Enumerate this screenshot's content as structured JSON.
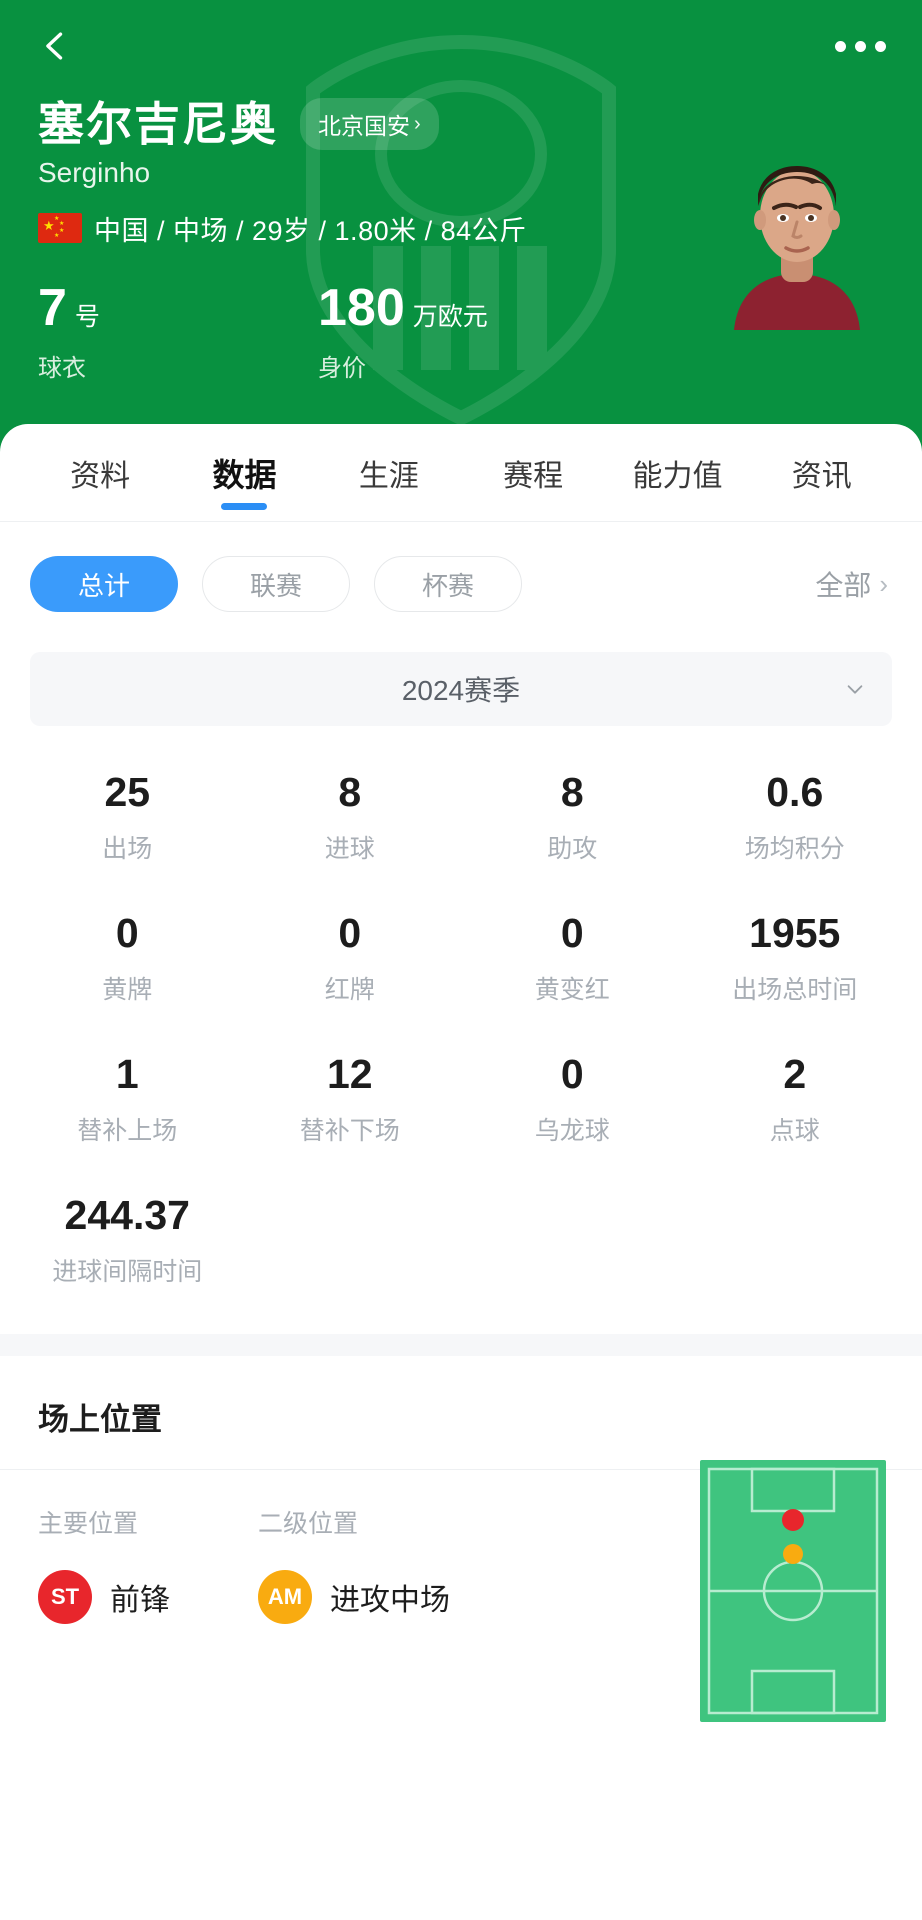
{
  "topbar": {
    "back_icon": "chevron-left-icon",
    "more_icon": "more-options-icon"
  },
  "player": {
    "name_cn": "塞尔吉尼奥",
    "name_en": "Serginho",
    "team": "北京国安",
    "team_chevron": "›",
    "nationality": "中国",
    "meta": "中国 / 中场 / 29岁 / 1.80米 / 84公斤",
    "jersey_number": "7",
    "jersey_unit": "号",
    "jersey_label": "球衣",
    "value_number": "180",
    "value_unit": "万欧元",
    "value_label": "身价"
  },
  "tabs": [
    {
      "label": "资料",
      "active": false
    },
    {
      "label": "数据",
      "active": true
    },
    {
      "label": "生涯",
      "active": false
    },
    {
      "label": "赛程",
      "active": false
    },
    {
      "label": "能力值",
      "active": false
    },
    {
      "label": "资讯",
      "active": false
    }
  ],
  "filters": {
    "chips": [
      {
        "label": "总计",
        "active": true
      },
      {
        "label": "联赛",
        "active": false
      },
      {
        "label": "杯赛",
        "active": false
      }
    ],
    "all_label": "全部",
    "all_chevron": "›"
  },
  "season": {
    "label": "2024赛季",
    "chevron_icon": "chevron-down-icon"
  },
  "stats": [
    {
      "value": "25",
      "label": "出场"
    },
    {
      "value": "8",
      "label": "进球"
    },
    {
      "value": "8",
      "label": "助攻"
    },
    {
      "value": "0.6",
      "label": "场均积分"
    },
    {
      "value": "0",
      "label": "黄牌"
    },
    {
      "value": "0",
      "label": "红牌"
    },
    {
      "value": "0",
      "label": "黄变红"
    },
    {
      "value": "1955",
      "label": "出场总时间"
    },
    {
      "value": "1",
      "label": "替补上场"
    },
    {
      "value": "12",
      "label": "替补下场"
    },
    {
      "value": "0",
      "label": "乌龙球"
    },
    {
      "value": "2",
      "label": "点球"
    },
    {
      "value": "244.37",
      "label": "进球间隔时间"
    }
  ],
  "position_section": {
    "title": "场上位置",
    "primary_header": "主要位置",
    "secondary_header": "二级位置",
    "primary": {
      "code": "ST",
      "name": "前锋",
      "color": "#e8262c"
    },
    "secondary": {
      "code": "AM",
      "name": "进攻中场",
      "color": "#f9ab10"
    },
    "pitch": {
      "field_color": "#3fc47f",
      "line_color": "#b7ecd0",
      "markers": [
        {
          "code": "ST",
          "color": "#e8262c",
          "x": 50,
          "y": 27
        },
        {
          "code": "AM",
          "color": "#f9ab10",
          "x": 50,
          "y": 40
        }
      ]
    }
  },
  "colors": {
    "brand_green": "#089140",
    "accent_blue": "#3a9bfb",
    "tab_indicator": "#2b8ef5"
  }
}
